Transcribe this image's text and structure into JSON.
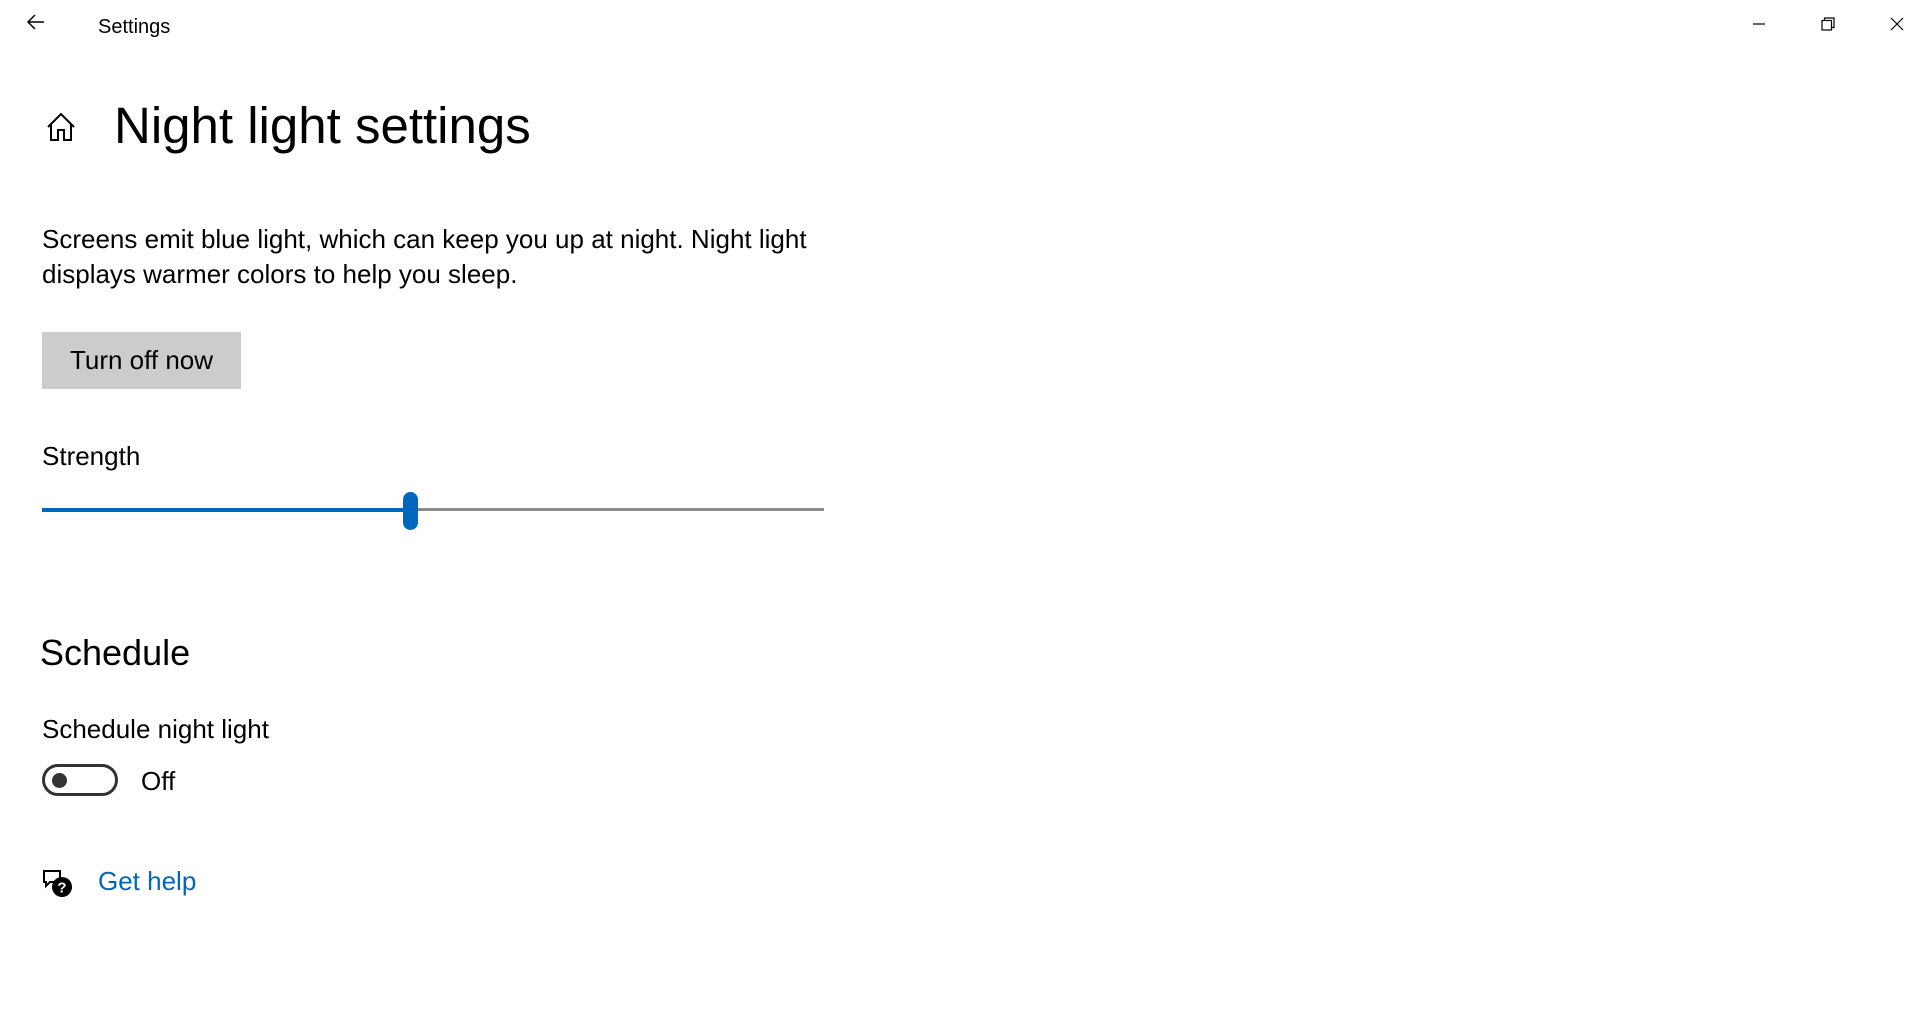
{
  "window": {
    "title": "Settings"
  },
  "icons": {
    "back": "back-arrow-icon",
    "minimize": "minimize-icon",
    "maximize": "restore-icon",
    "close": "close-icon",
    "home": "home-icon",
    "help": "help-chat-icon"
  },
  "page": {
    "title": "Night light settings",
    "description": "Screens emit blue light, which can keep you up at night. Night light displays warmer colors to help you sleep.",
    "turn_off_button": "Turn off now",
    "strength": {
      "label": "Strength",
      "value_fraction": 0.47
    }
  },
  "schedule": {
    "heading": "Schedule",
    "toggle_label": "Schedule night light",
    "toggle_on": false,
    "toggle_state_text": "Off"
  },
  "help": {
    "link_text": "Get help"
  },
  "colors": {
    "accent": "#0067c0",
    "button_bg": "#cccccc",
    "track": "#8a8a8a"
  }
}
